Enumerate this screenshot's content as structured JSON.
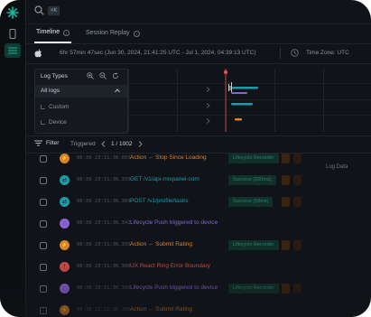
{
  "search": {
    "shortcut": "⌘K"
  },
  "tabs": [
    {
      "label": "Timeline",
      "active": true
    },
    {
      "label": "Session Replay",
      "active": false
    }
  ],
  "session": {
    "platform_icon": "apple-icon",
    "duration_text": "6hr 57min 47sec (Jun 30, 2024, 21:41:25 UTC - Jul 1, 2024, 04:39:13 UTC)",
    "timezone_label": "Time Zone: UTC"
  },
  "log_types": {
    "title": "Log Types",
    "items": [
      {
        "label": "All logs",
        "selected": true
      },
      {
        "label": "Custom",
        "selected": false
      },
      {
        "label": "Device",
        "selected": false
      }
    ]
  },
  "filter_bar": {
    "filter_label": "Filter",
    "triggered_label": "Triggered",
    "page_text": "1 / 1002"
  },
  "events": [
    {
      "time": "06:30 23:31:36.805",
      "text": "Action ← Stop Since Loading",
      "color": "#d9822b",
      "icon": "bolt-icon",
      "badge": "Lifecycle Recorder"
    },
    {
      "time": "06:30 23:31:36.305",
      "text": "GET /v1/api-mixpanel-com",
      "color": "#1f9aa8",
      "icon": "network-icon",
      "badge": "Success (200ms)"
    },
    {
      "time": "06:30 23:31:36.309",
      "text": "POST /v1/profile/tasks",
      "color": "#1f9aa8",
      "icon": "network-icon",
      "badge": "Success (58ms)"
    },
    {
      "time": "06:30 23:31:36.342",
      "text": "Lifecycle Push triggered to device",
      "color": "#8a63d2",
      "icon": "lifecycle-icon",
      "badge": ""
    },
    {
      "time": "06:30 23:31:36.305",
      "text": "Action ← Submit Rating",
      "color": "#d9822b",
      "icon": "bolt-icon",
      "badge": "Lifecycle Recorder"
    },
    {
      "time": "06:30 23:31:36.306",
      "text": "UX React Ring Error Boundary",
      "color": "#c24b4b",
      "icon": "error-icon",
      "badge": ""
    },
    {
      "time": "06:30 23:31:36.305",
      "text": "Lifecycle Push triggered to device",
      "color": "#8a63d2",
      "icon": "lifecycle-icon",
      "badge": "Lifecycle Recorder"
    },
    {
      "time": "06:30 23:31:36.305",
      "text": "Action ← Submit Rating",
      "color": "#d9822b",
      "icon": "bolt-icon",
      "badge": ""
    }
  ],
  "side_label": "Log Data",
  "colors": {
    "accent": "#17b79a",
    "background": "#101317",
    "action": "#d9822b",
    "network": "#1f9aa8",
    "lifecycle": "#8a63d2",
    "error": "#c24b4b",
    "marker": "#e5484d"
  }
}
